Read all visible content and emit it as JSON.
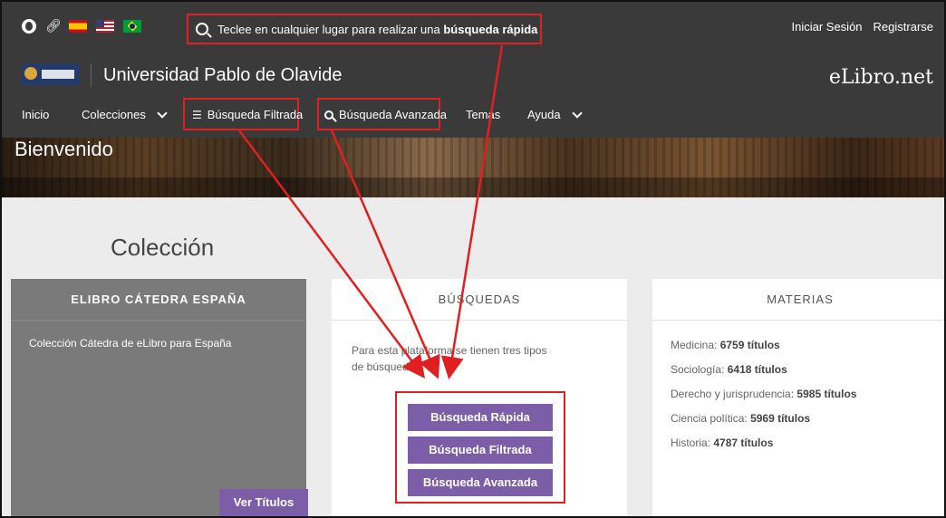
{
  "topbar": {
    "icons": [
      "globe-icon",
      "link-icon",
      "flag-es-icon",
      "flag-us-icon",
      "flag-br-icon"
    ],
    "search_prefix": "Teclee en cualquier lugar para realizar una",
    "search_bold": "búsqueda rápida",
    "login": "Iniciar Sesión",
    "register": "Registrarse"
  },
  "header": {
    "university": "Universidad Pablo de Olavide",
    "brand": "eLibro.net"
  },
  "nav": {
    "inicio": "Inicio",
    "colecciones": "Colecciones",
    "busqueda_filtrada": "Búsqueda Filtrada",
    "busqueda_avanzada": "Búsqueda Avanzada",
    "temas": "Temas",
    "ayuda": "Ayuda"
  },
  "hero": {
    "title": "Bienvenido"
  },
  "main": {
    "section_title": "Colección",
    "catedra": {
      "title": "ELIBRO CÁTEDRA ESPAÑA",
      "text": "Colección Cátedra de eLibro para España",
      "button": "Ver Títulos"
    },
    "busquedas": {
      "title": "BÚSQUEDAS",
      "text": "Para esta plataforma se tienen tres tipos de búsquedas:",
      "buttons": [
        "Búsqueda Rápida",
        "Búsqueda Filtrada",
        "Búsqueda Avanzada"
      ]
    },
    "materias": {
      "title": "MATERIAS",
      "items": [
        {
          "label": "Medicina:",
          "count": "6759 títulos"
        },
        {
          "label": "Sociología:",
          "count": "6418 títulos"
        },
        {
          "label": "Derecho y jurisprudencia:",
          "count": "5985 títulos"
        },
        {
          "label": "Ciencia política:",
          "count": "5969 títulos"
        },
        {
          "label": "Historia:",
          "count": "4787 títulos"
        }
      ]
    }
  },
  "colors": {
    "accent": "#7b5ea7",
    "highlight": "#e02020",
    "bar": "#3a3a3a"
  }
}
